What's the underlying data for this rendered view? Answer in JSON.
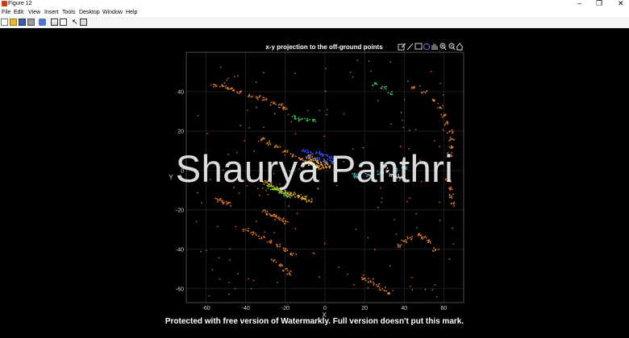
{
  "window": {
    "title": "Figure 12",
    "controls": [
      "–",
      "❐",
      "✕"
    ]
  },
  "menu": [
    "File",
    "Edit",
    "View",
    "Insert",
    "Tools",
    "Desktop",
    "Window",
    "Help"
  ],
  "toolbar": [
    "new-figure-icon",
    "open-icon",
    "save-icon",
    "print-icon",
    "link-icon",
    "colorbar-icon",
    "legend-icon",
    "pointer-icon",
    "property-editor-icon"
  ],
  "axes_toolbar": [
    "export-icon",
    "brush-icon",
    "datatip-icon",
    "rotate-icon",
    "pan-icon",
    "zoom-in-icon",
    "zoom-out-icon",
    "home-icon"
  ],
  "colors": {
    "background": "#000000",
    "grid": "#3a3a3a",
    "tick_text": "#d6d6d6"
  },
  "watermark": {
    "text": "Shaurya Panthri",
    "notice": "Protected with free version of Watermarkly. Full version doesn't put this mark."
  },
  "chart_data": {
    "type": "scatter",
    "title": "x-y projection to the off-ground points",
    "xlabel": "X",
    "ylabel": "Y",
    "xlim": [
      -70,
      70
    ],
    "ylim": [
      -67,
      60
    ],
    "xticks": [
      -60,
      -40,
      -20,
      0,
      20,
      40,
      60
    ],
    "yticks": [
      40,
      20,
      0,
      -20,
      -40,
      -60
    ],
    "grid": true,
    "clusters": [
      {
        "x": [
          -55,
          -52,
          -49,
          -46,
          -43
        ],
        "y": [
          43,
          43.5,
          42,
          41,
          40
        ],
        "color": "#e07a2a"
      },
      {
        "x": [
          -38,
          -34,
          -30,
          -26,
          -22,
          -20
        ],
        "y": [
          38,
          37,
          36,
          34,
          33,
          32
        ],
        "color": "#e07a2a"
      },
      {
        "x": [
          -15,
          -12,
          -9,
          -6
        ],
        "y": [
          27,
          26,
          25.5,
          25
        ],
        "color": "#37c24b"
      },
      {
        "x": [
          -32,
          -28,
          -24,
          -20,
          -16,
          -12,
          -8,
          -4,
          -2
        ],
        "y": [
          16,
          14,
          12,
          10,
          8,
          6,
          4,
          2,
          1
        ],
        "color": "#f09020"
      },
      {
        "x": [
          -8,
          -6,
          -4,
          -2,
          0,
          2
        ],
        "y": [
          7,
          6,
          5,
          4,
          3,
          2
        ],
        "color": "#ffb030"
      },
      {
        "x": [
          -10,
          -7,
          -4
        ],
        "y": [
          4,
          3,
          2
        ],
        "color": "#ffe080"
      },
      {
        "x": [
          -10,
          -7,
          -4,
          -1,
          2,
          4
        ],
        "y": [
          10,
          9,
          9,
          8,
          7,
          6
        ],
        "color": "#3050ff"
      },
      {
        "x": [
          -8,
          -4,
          0,
          4
        ],
        "y": [
          7,
          6,
          5,
          4
        ],
        "color": "#4060ff"
      },
      {
        "x": [
          30,
          32,
          34,
          36,
          38
        ],
        "y": [
          2,
          0,
          -2,
          -3,
          -4
        ],
        "color": "#d8d8d8"
      },
      {
        "x": [
          -30,
          -28,
          -26,
          -24,
          -22,
          -20,
          -18,
          -16,
          -14,
          -12,
          -10,
          -8
        ],
        "y": [
          -6,
          -7,
          -8,
          -9,
          -10,
          -11,
          -12,
          -12,
          -13,
          -14,
          -14,
          -15
        ],
        "color": "#e6b020"
      },
      {
        "x": [
          -28,
          -26,
          -24,
          -22,
          -20,
          -18
        ],
        "y": [
          -8,
          -9,
          -10,
          -11,
          -12,
          -13
        ],
        "color": "#7fd03a"
      },
      {
        "x": [
          -54,
          -51,
          -49
        ],
        "y": [
          -15,
          -16,
          -17
        ],
        "color": "#f07030"
      },
      {
        "x": [
          -30,
          -28,
          -26,
          -24,
          -22,
          -20
        ],
        "y": [
          -21,
          -22,
          -23,
          -24,
          -25,
          -26
        ],
        "color": "#e07a2a"
      },
      {
        "x": [
          -40,
          -36,
          -32,
          -28,
          -24,
          -20,
          -16
        ],
        "y": [
          -30,
          -32,
          -34,
          -36,
          -38,
          -40,
          -42
        ],
        "color": "#e07a2a"
      },
      {
        "x": [
          -26,
          -23,
          -20,
          -18
        ],
        "y": [
          -46,
          -48,
          -50,
          -52
        ],
        "color": "#e07a2a"
      },
      {
        "x": [
          37,
          40,
          43,
          47,
          50,
          53,
          56
        ],
        "y": [
          -38,
          -36,
          -34,
          -33,
          -34,
          -36,
          -40
        ],
        "color": "#e07a2a"
      },
      {
        "x": [
          20,
          23,
          26,
          29,
          32
        ],
        "y": [
          -55,
          -56,
          -58,
          -60,
          -62
        ],
        "color": "#e07a2a"
      },
      {
        "x": [
          60,
          62,
          63,
          64,
          64,
          63
        ],
        "y": [
          28,
          24,
          20,
          16,
          12,
          8
        ],
        "color": "#e07a2a"
      },
      {
        "x": [
          45,
          50,
          55,
          58
        ],
        "y": [
          42,
          40,
          36,
          32
        ],
        "color": "#e07a2a"
      },
      {
        "x": [
          62,
          63,
          64,
          65
        ],
        "y": [
          -5,
          -9,
          -13,
          -17
        ],
        "color": "#e07a2a"
      },
      {
        "x": [
          15,
          16,
          22,
          28,
          35,
          40
        ],
        "y": [
          -2,
          -3,
          -2,
          -1,
          0,
          1
        ],
        "color": "#40c0d0"
      },
      {
        "x": [
          25,
          30,
          33
        ],
        "y": [
          44,
          42,
          39
        ],
        "color": "#3ab060"
      }
    ],
    "scatter_noise_color": "#c85a20"
  }
}
